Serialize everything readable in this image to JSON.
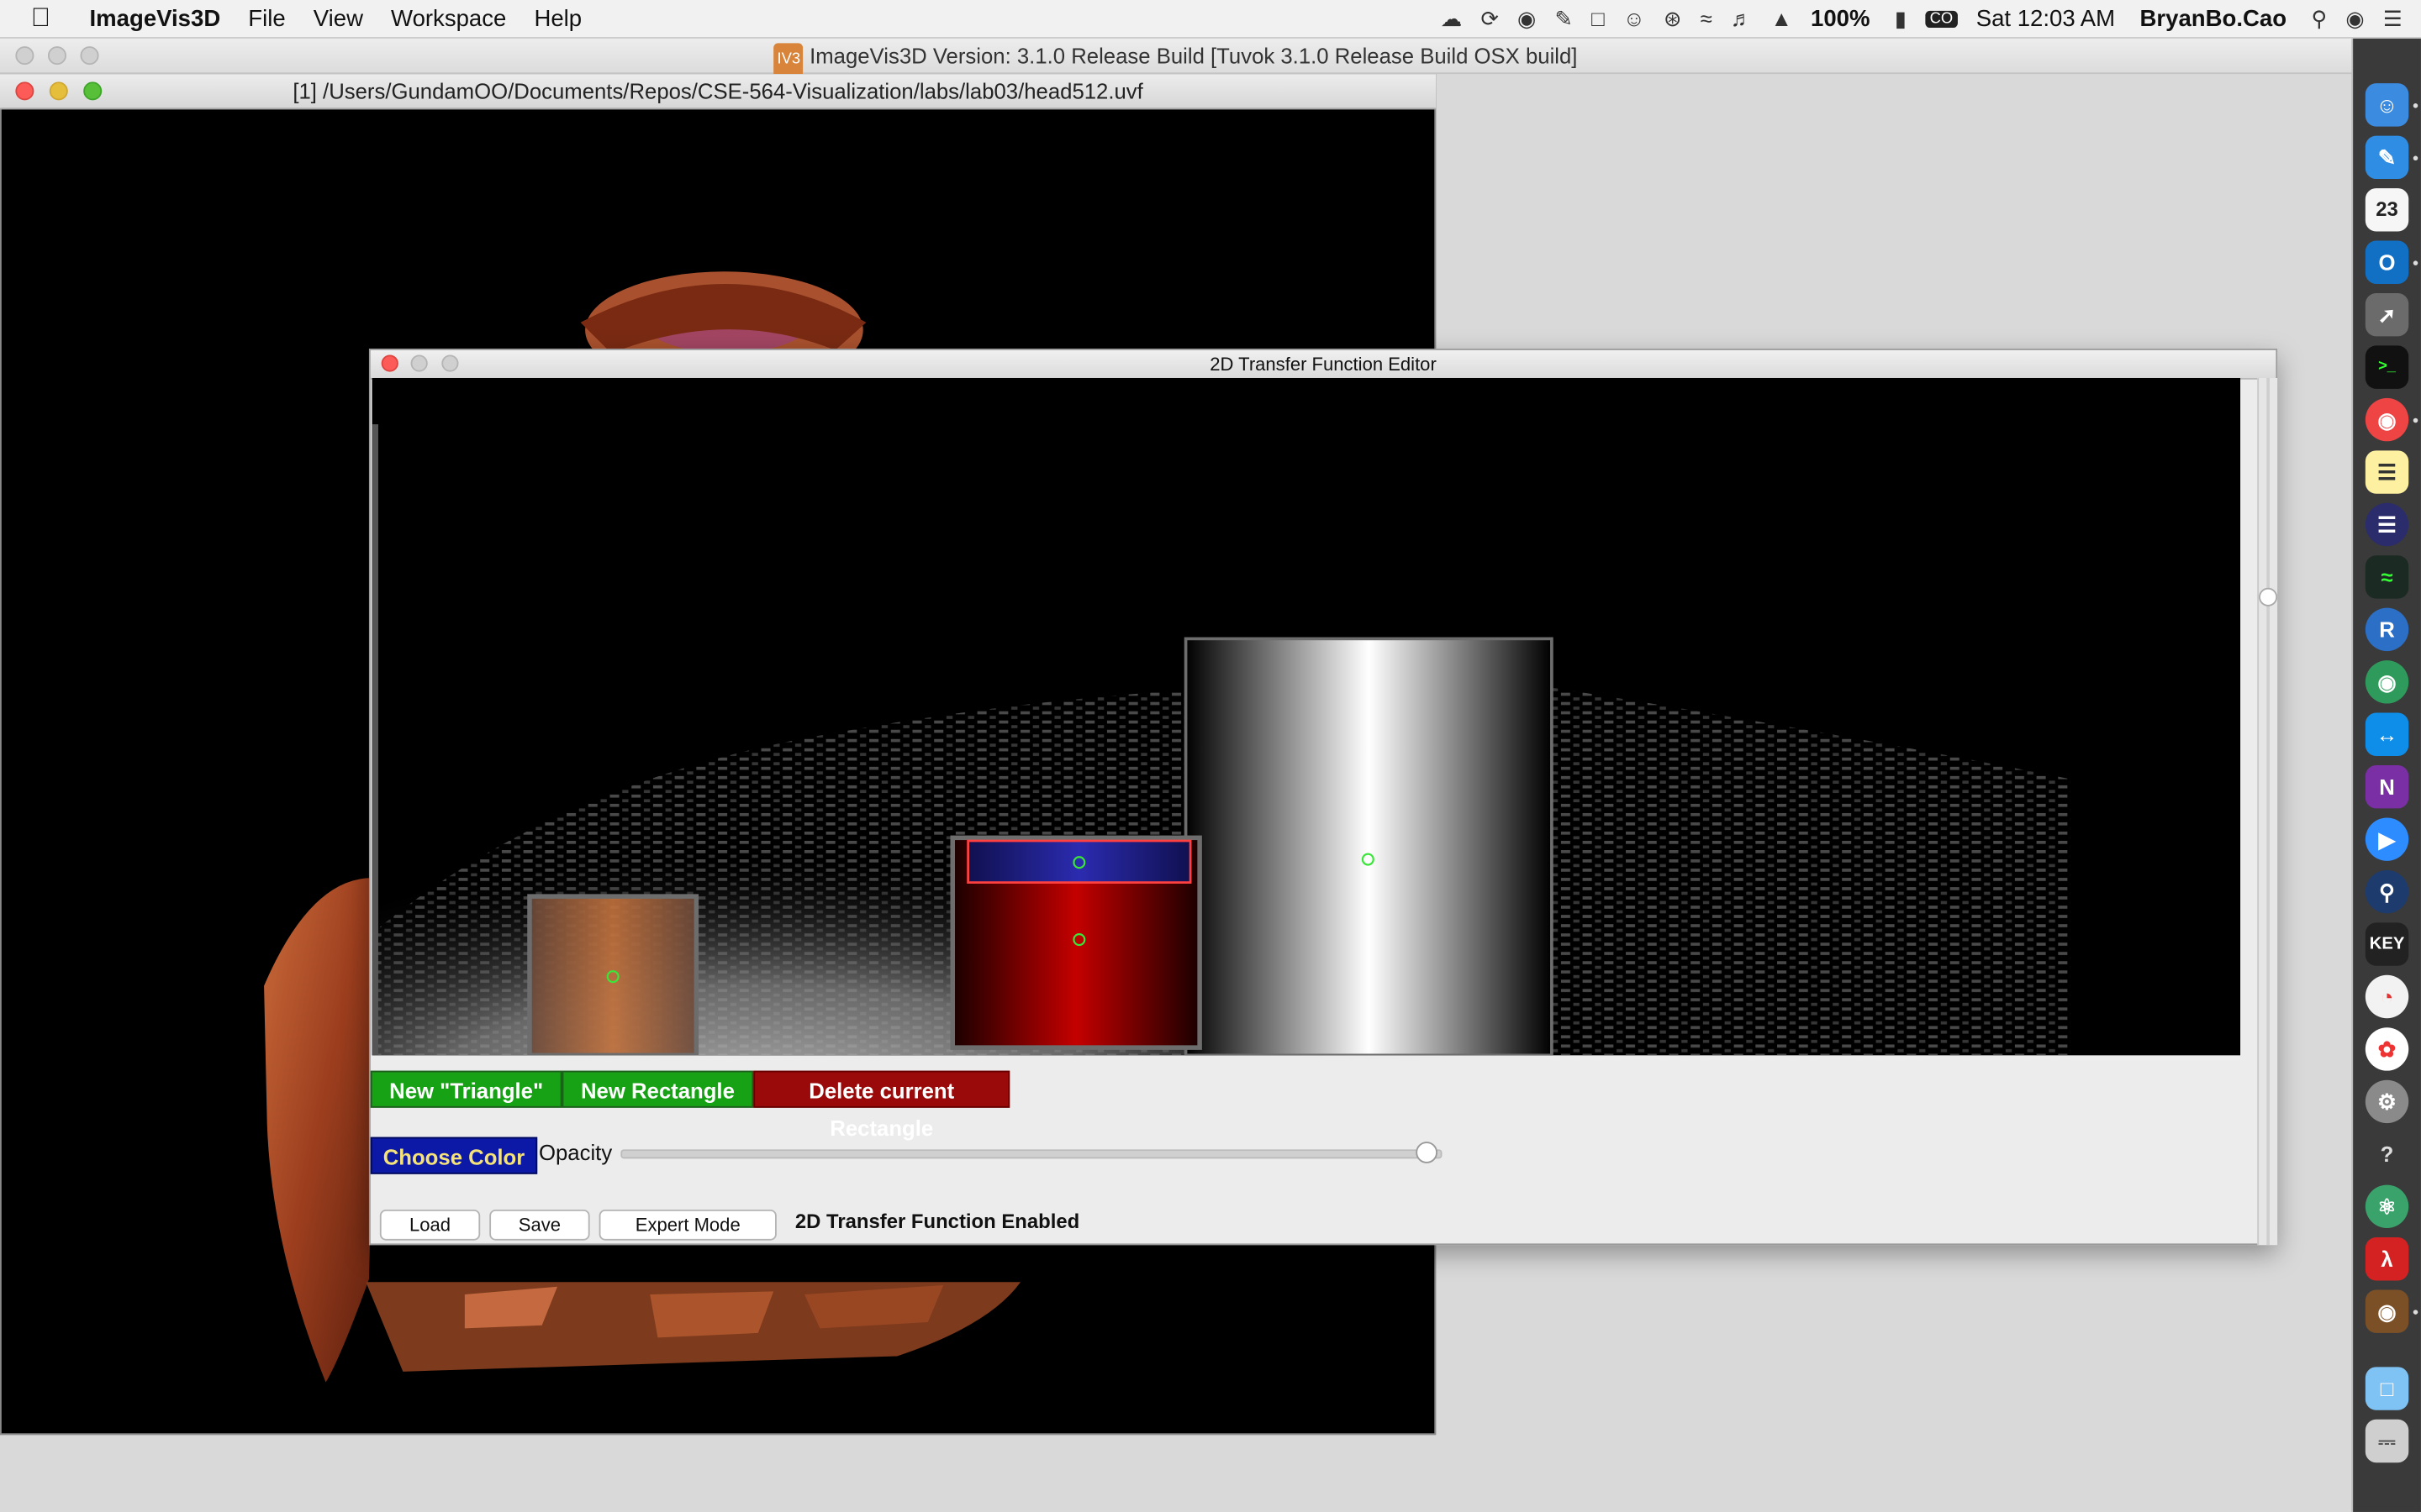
{
  "menubar": {
    "app": "ImageVis3D",
    "items": [
      "File",
      "View",
      "Workspace",
      "Help"
    ],
    "battery": "100%",
    "clock": "Sat 12:03 AM",
    "user": "BryanBo.Cao",
    "input_badge": "CO"
  },
  "main_window": {
    "title": "ImageVis3D Version: 3.1.0 Release Build [Tuvok 3.1.0 Release Build OSX build]",
    "title_badge": "IV3"
  },
  "render_window": {
    "title": "[1] /Users/GundamOO/Documents/Repos/CSE-564-Visualization/labs/lab03/head512.uvf"
  },
  "tf_editor": {
    "title": "2D Transfer Function Editor",
    "buttons": {
      "new_triangle": "New \"Triangle\"",
      "new_rectangle": "New Rectangle",
      "delete_rectangle": "Delete current Rectangle",
      "choose_color": "Choose Color",
      "load": "Load",
      "save": "Save",
      "expert_mode": "Expert Mode"
    },
    "opacity_label": "Opacity",
    "opacity_value": 0.98,
    "status": "2D Transfer Function Enabled"
  },
  "colors": {
    "green_button": "#17a114",
    "red_button": "#9a0a0a",
    "choose_color_bg": "#0c18a6",
    "choose_color_text": "#f5e37a"
  },
  "dock": {
    "icons": [
      "finder-icon",
      "pen-icon",
      "calendar-icon",
      "outlook-icon",
      "launchpad-icon",
      "terminal-icon",
      "chrome-icon",
      "notes-icon",
      "eclipse-icon",
      "activity-monitor-icon",
      "r-icon",
      "browser-icon",
      "teamviewer-icon",
      "onenote-icon",
      "zoom-icon",
      "quicktime-icon",
      "keynote-icon",
      "disk-icon",
      "photos-icon",
      "settings-icon",
      "help-icon",
      "atom-icon",
      "acrobat-icon",
      "imagevis3d-icon",
      "folder-icon",
      "trash-icon"
    ],
    "calendar_day": "23",
    "onenote_letter": "N",
    "outlook_letter": "O",
    "r_letter": "R",
    "keynote_text": "KEY",
    "help_glyph": "?"
  }
}
